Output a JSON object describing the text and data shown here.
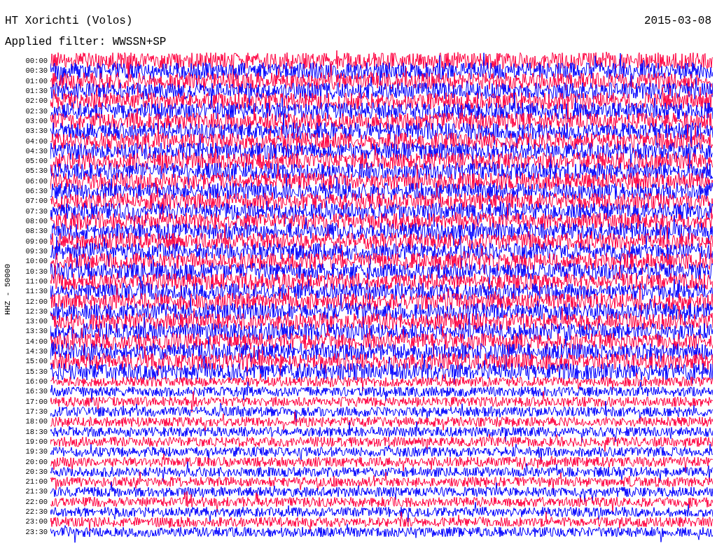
{
  "title": "HT Xorichti (Volos)",
  "date": "2015-03-08",
  "filter_label": "Applied filter: WWSSN+SP",
  "channel_label": "HHZ - 50000",
  "rows": [
    {
      "time": "00:00",
      "color": "#ff0040"
    },
    {
      "time": "00:30",
      "color": "#0000ff"
    },
    {
      "time": "01:00",
      "color": "#ff0040"
    },
    {
      "time": "01:30",
      "color": "#0000ff"
    },
    {
      "time": "02:00",
      "color": "#ff0040"
    },
    {
      "time": "02:30",
      "color": "#0000ff"
    },
    {
      "time": "03:00",
      "color": "#ff0040"
    },
    {
      "time": "03:30",
      "color": "#0000ff"
    },
    {
      "time": "04:00",
      "color": "#ff0040"
    },
    {
      "time": "04:30",
      "color": "#0000ff"
    },
    {
      "time": "05:00",
      "color": "#ff0040"
    },
    {
      "time": "05:30",
      "color": "#0000ff"
    },
    {
      "time": "06:00",
      "color": "#ff0040"
    },
    {
      "time": "06:30",
      "color": "#0000ff"
    },
    {
      "time": "07:00",
      "color": "#ff0040"
    },
    {
      "time": "07:30",
      "color": "#0000ff"
    },
    {
      "time": "08:00",
      "color": "#ff0040"
    },
    {
      "time": "08:30",
      "color": "#0000ff"
    },
    {
      "time": "09:00",
      "color": "#ff0040"
    },
    {
      "time": "09:30",
      "color": "#0000ff"
    },
    {
      "time": "10:00",
      "color": "#ff0040"
    },
    {
      "time": "10:30",
      "color": "#0000ff"
    },
    {
      "time": "11:00",
      "color": "#ff0040"
    },
    {
      "time": "11:30",
      "color": "#0000ff"
    },
    {
      "time": "12:00",
      "color": "#ff0040"
    },
    {
      "time": "12:30",
      "color": "#0000ff"
    },
    {
      "time": "13:00",
      "color": "#ff0040"
    },
    {
      "time": "13:30",
      "color": "#0000ff"
    },
    {
      "time": "14:00",
      "color": "#ff0040"
    },
    {
      "time": "14:30",
      "color": "#0000ff"
    },
    {
      "time": "15:00",
      "color": "#ff0040"
    },
    {
      "time": "15:30",
      "color": "#0000ff"
    },
    {
      "time": "16:00",
      "color": "#ff0040"
    },
    {
      "time": "16:30",
      "color": "#0000ff"
    },
    {
      "time": "17:00",
      "color": "#ff0040"
    },
    {
      "time": "17:30",
      "color": "#0000ff"
    },
    {
      "time": "18:00",
      "color": "#ff0040"
    },
    {
      "time": "18:30",
      "color": "#0000ff"
    },
    {
      "time": "19:00",
      "color": "#ff0040"
    },
    {
      "time": "19:30",
      "color": "#0000ff"
    },
    {
      "time": "20:00",
      "color": "#ff0040"
    },
    {
      "time": "20:30",
      "color": "#0000ff"
    },
    {
      "time": "21:00",
      "color": "#ff0040"
    },
    {
      "time": "21:30",
      "color": "#0000ff"
    },
    {
      "time": "22:00",
      "color": "#ff0040"
    },
    {
      "time": "22:30",
      "color": "#0000ff"
    },
    {
      "time": "23:00",
      "color": "#ff0040"
    },
    {
      "time": "23:30",
      "color": "#0000ff"
    }
  ]
}
